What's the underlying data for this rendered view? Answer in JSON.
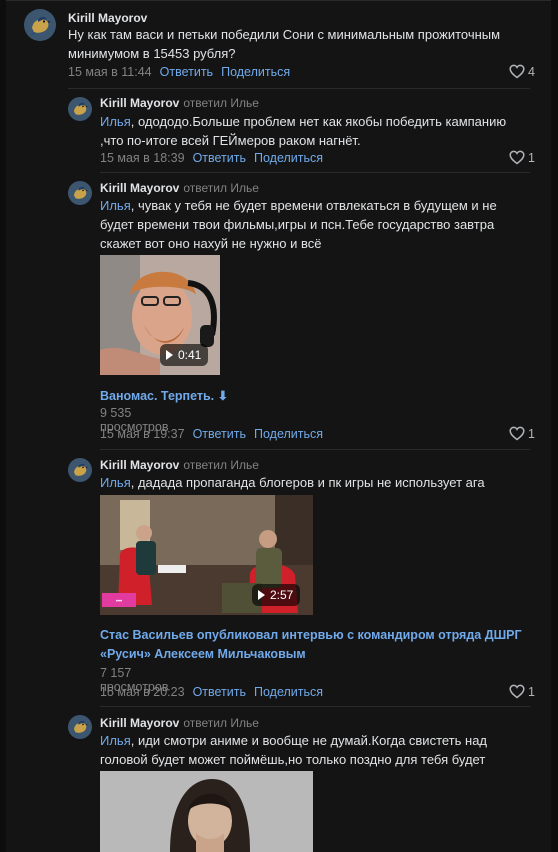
{
  "comments": [
    {
      "author": "Kirill Mayorov",
      "reply_to": "",
      "text": "Ну как там васи и петьки победили Сони с минимальным прожиточным минимумом в 15453 рубля?",
      "date": "15 мая в 11:44",
      "reply_label": "Ответить",
      "share_label": "Поделиться",
      "likes": "4"
    },
    {
      "author": "Kirill Mayorov",
      "reply_to": "ответил Илье",
      "mention": "Илья",
      "text": ", одододо.Больше проблем нет как якобы победить кампанию ,что по-итоге всей ГЕЙмеров раком нагнёт.",
      "date": "15 мая в 18:39",
      "reply_label": "Ответить",
      "share_label": "Поделиться",
      "likes": "1"
    },
    {
      "author": "Kirill Mayorov",
      "reply_to": "ответил Илье",
      "mention": "Илья",
      "text": ", чувак у тебя не будет времени отвлекаться в будущем и не будет времени твои фильмы,игры и псн.Тебе государство завтра скажет вот оно нахуй не нужно и всё",
      "video": {
        "duration": "0:41",
        "title": "Ваномас. Терпеть. ⬇",
        "views": "9 535 просмотров"
      },
      "date": "15 мая в 19:37",
      "reply_label": "Ответить",
      "share_label": "Поделиться",
      "likes": "1"
    },
    {
      "author": "Kirill Mayorov",
      "reply_to": "ответил Илье",
      "mention": "Илья",
      "text": ", дадада пропаганда блогеров и пк игры не использует ага",
      "video": {
        "duration": "2:57",
        "title": "Стас Васильев опубликовал интервью с командиром отряда ДШРГ «Русич» Алексеем Мильчаковым",
        "views": "7 157 просмотров"
      },
      "date": "15 мая в 20:23",
      "reply_label": "Ответить",
      "share_label": "Поделиться",
      "likes": "1"
    },
    {
      "author": "Kirill Mayorov",
      "reply_to": "ответил Илье",
      "mention": "Илья",
      "text": ", иди смотри аниме и вообще не думай.Когда свистеть над головой будет может поймёшь,но только поздно для тебя будет"
    }
  ],
  "icons": {
    "like": "heart-icon",
    "play": "play-icon",
    "avatar": "bird-avatar"
  },
  "colors": {
    "background": "#141414",
    "accent": "#71aaeb",
    "secondary": "#828282",
    "text": "#e1e3e6"
  }
}
